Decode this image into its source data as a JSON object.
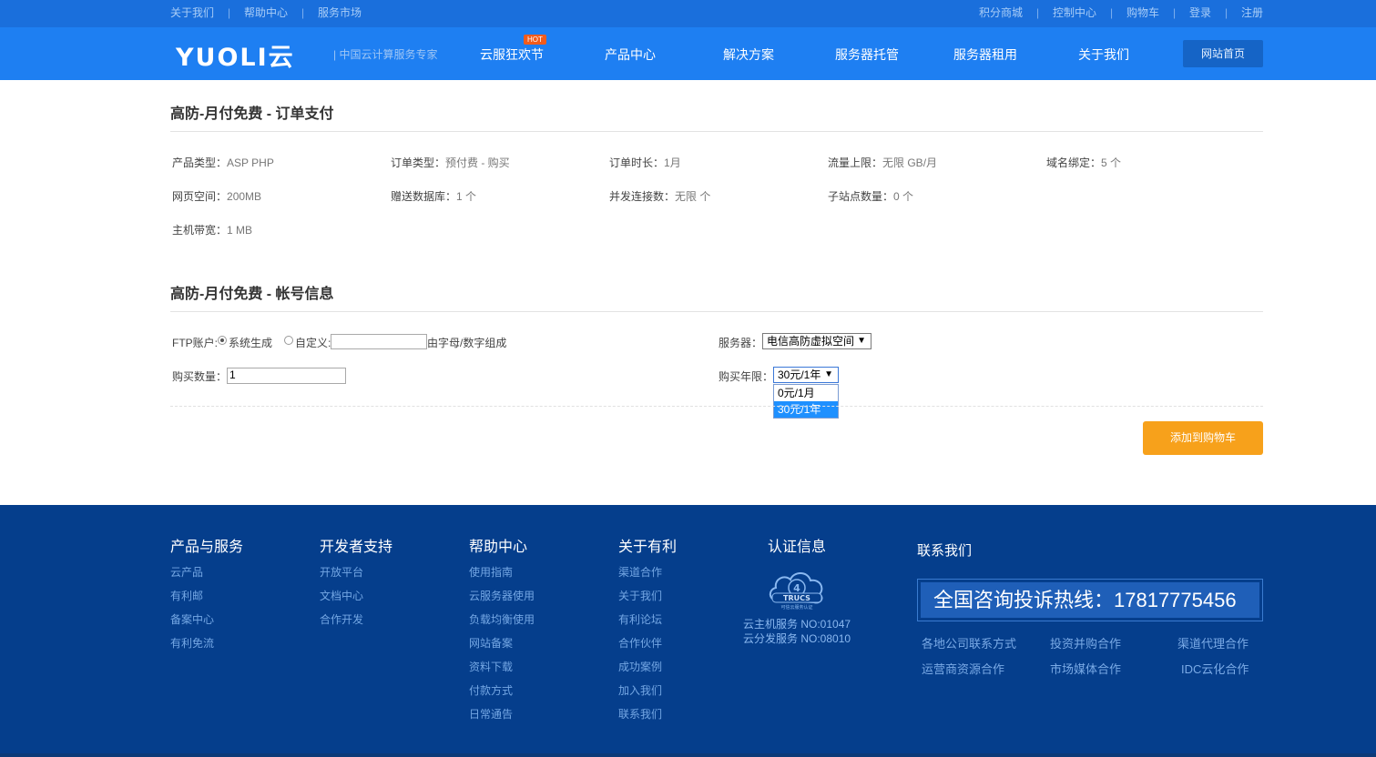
{
  "topbar": {
    "left_links": [
      "关于我们",
      "帮助中心",
      "服务市场"
    ],
    "right_links": [
      "积分商城",
      "控制中心",
      "购物车",
      "登录",
      "注册"
    ],
    "separator": "|"
  },
  "header": {
    "logo": "YUOLI云",
    "slogan": "| 中国云计算服务专家",
    "nav": [
      "云服狂欢节",
      "产品中心",
      "解决方案",
      "服务器托管",
      "服务器租用",
      "关于我们"
    ],
    "hot_badge": "HOT",
    "home_button": "网站首页"
  },
  "order": {
    "title": "高防-月付免费 - 订单支付",
    "fields": [
      {
        "label": "产品类型：",
        "value": "ASP PHP"
      },
      {
        "label": "订单类型：",
        "value": "预付费 - 购买"
      },
      {
        "label": "订单时长：",
        "value": "1月"
      },
      {
        "label": "流量上限：",
        "value": "无限 GB/月"
      },
      {
        "label": "域名绑定：",
        "value": "5 个"
      },
      {
        "label": "网页空间：",
        "value": "200MB"
      },
      {
        "label": "赠送数据库：",
        "value": "1 个"
      },
      {
        "label": "并发连接数：",
        "value": "无限 个"
      },
      {
        "label": "子站点数量：",
        "value": "0 个"
      },
      {
        "label": "主机带宽：",
        "value": "1 MB"
      }
    ]
  },
  "account": {
    "title": "高防-月付免费 - 帐号信息",
    "ftp_label": "FTP账户:",
    "radio_system": "系统生成",
    "radio_custom": "自定义:",
    "custom_value": "",
    "custom_hint": "由字母/数字组成",
    "qty_label": "购买数量：",
    "qty_value": "1",
    "server_label": "服务器：",
    "server_value": "电信高防虚拟空间",
    "term_label": "购买年限：",
    "term_value": "30元/1年",
    "term_options": [
      "0元/1月",
      "30元/1年"
    ],
    "add_to_cart": "添加到购物车"
  },
  "footer": {
    "columns": [
      {
        "title": "产品与服务",
        "links": [
          "云产品",
          "有利邮",
          "备案中心",
          "有利免流"
        ]
      },
      {
        "title": "开发者支持",
        "links": [
          "开放平台",
          "文档中心",
          "合作开发"
        ]
      },
      {
        "title": "帮助中心",
        "links": [
          "使用指南",
          "云服务器使用",
          "负载均衡使用",
          "网站备案",
          "资料下载",
          "付款方式",
          "日常通告"
        ]
      },
      {
        "title": "关于有利",
        "links": [
          "渠道合作",
          "关于我们",
          "有利论坛",
          "合作伙伴",
          "成功案例",
          "加入我们",
          "联系我们"
        ]
      }
    ],
    "cert": {
      "title": "认证信息",
      "badge_text": "TRUCS",
      "badge_subtext": "可信云服务认证",
      "lines": [
        "云主机服务 NO:01047",
        "云分发服务 NO:08010"
      ]
    },
    "contact": {
      "title": "联系我们",
      "hotline": "全国咨询投诉热线：17817775456",
      "links": [
        "各地公司联系方式",
        "投资并购合作",
        "渠道代理合作",
        "运营商资源合作",
        "市场媒体合作",
        "IDC云化合作"
      ]
    }
  }
}
